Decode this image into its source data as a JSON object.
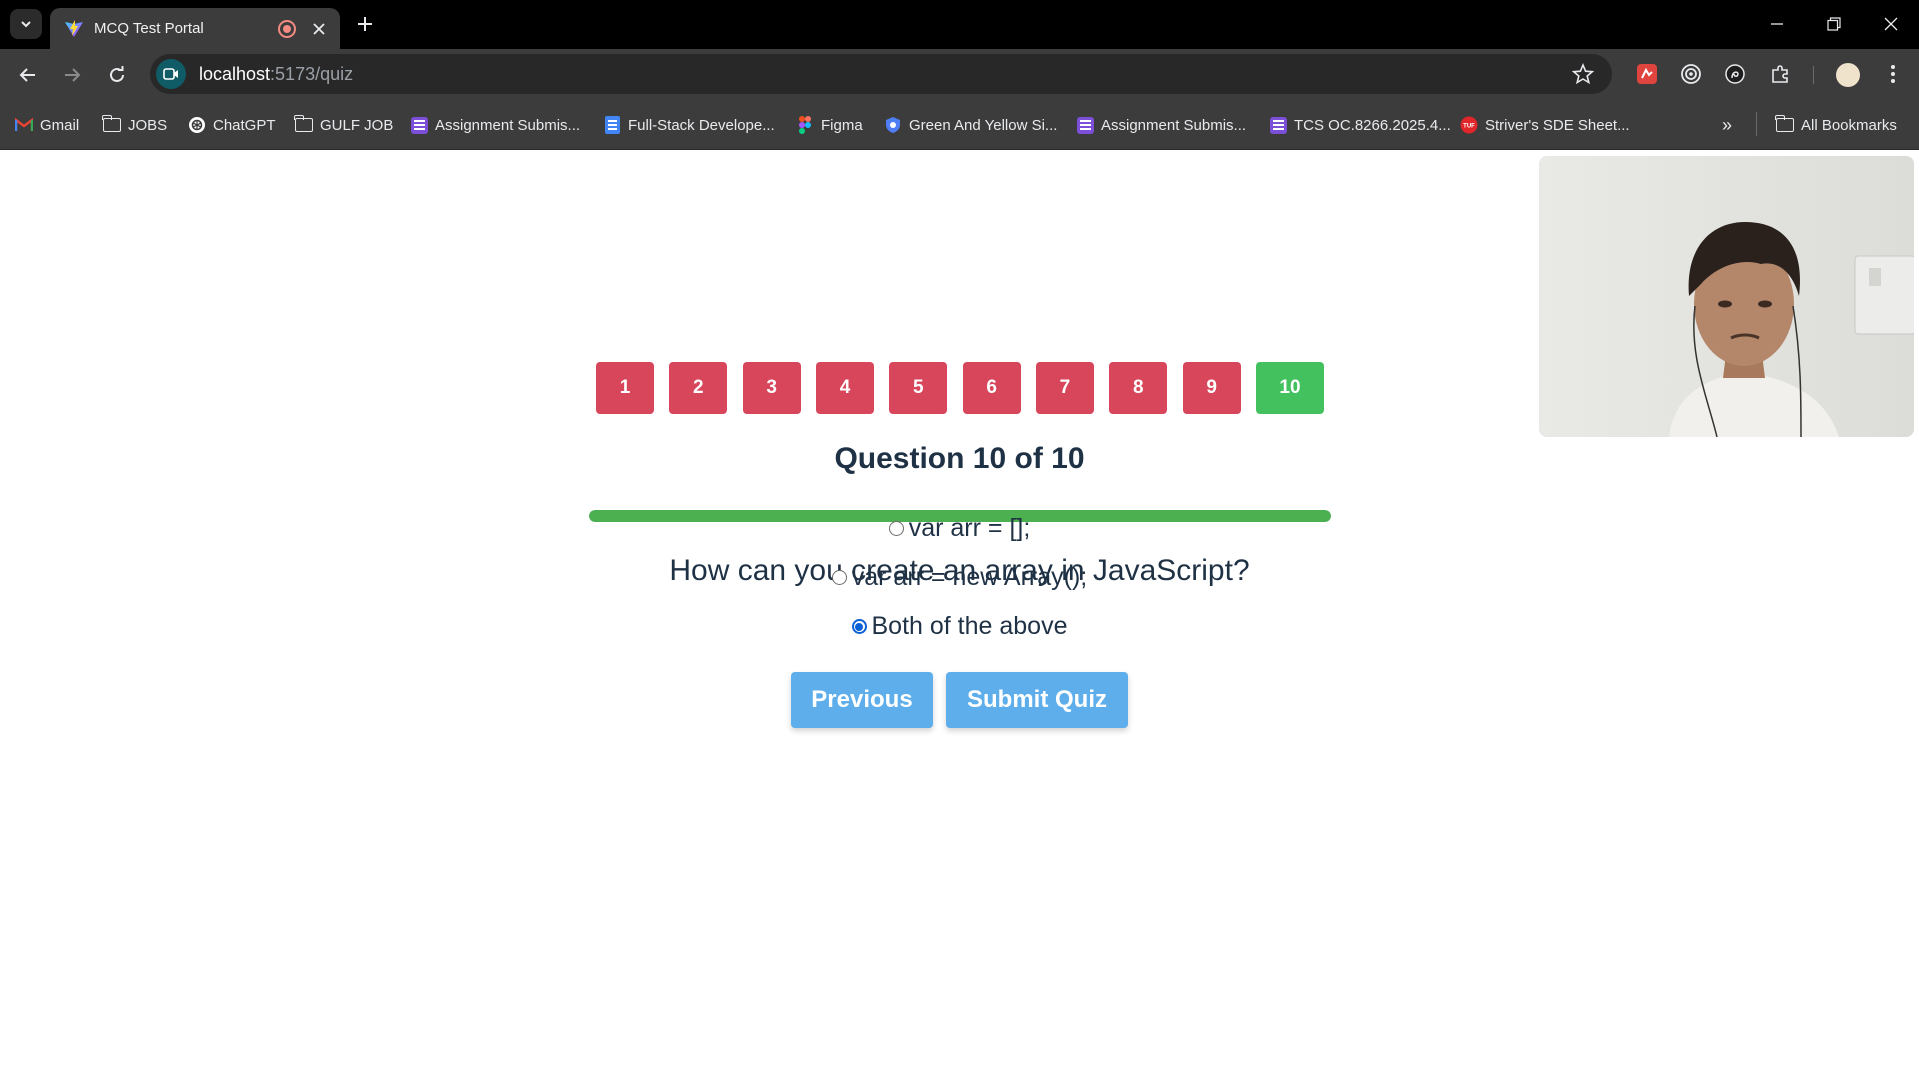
{
  "browser": {
    "tab_title": "MCQ Test Portal",
    "url_host": "localhost",
    "url_rest": ":5173/quiz",
    "bookmarks": [
      {
        "label": "Gmail",
        "icon": "gmail-icon"
      },
      {
        "label": "JOBS",
        "icon": "folder-icon"
      },
      {
        "label": "ChatGPT",
        "icon": "chatgpt-icon"
      },
      {
        "label": "GULF JOB",
        "icon": "folder-icon"
      },
      {
        "label": "Assignment Submis...",
        "icon": "form-icon"
      },
      {
        "label": "Full-Stack Develope...",
        "icon": "doc-icon"
      },
      {
        "label": "Figma",
        "icon": "figma-icon"
      },
      {
        "label": "Green And Yellow Si...",
        "icon": "shield-icon"
      },
      {
        "label": "Assignment Submis...",
        "icon": "form-icon"
      },
      {
        "label": "TCS OC.8266.2025.4...",
        "icon": "form-icon"
      },
      {
        "label": "Striver's SDE Sheet...",
        "icon": "tuf-icon"
      }
    ],
    "more_bookmarks": "»",
    "all_bookmarks": "All Bookmarks"
  },
  "quiz": {
    "question_numbers": [
      "1",
      "2",
      "3",
      "4",
      "5",
      "6",
      "7",
      "8",
      "9",
      "10"
    ],
    "current_question": 10,
    "heading": "Question 10 of 10",
    "progress_fraction": 1.0,
    "question": "How can you create an array in JavaScript?",
    "options": [
      "var arr = [];",
      "var arr = new Array();",
      "Both of the above"
    ],
    "selected_option": 2,
    "previous_label": "Previous",
    "submit_label": "Submit Quiz"
  },
  "colors": {
    "answered": "#d7465a",
    "current": "#43c15f",
    "progress": "#4caf50",
    "action_button": "#5daeea",
    "text": "#1f3145"
  }
}
